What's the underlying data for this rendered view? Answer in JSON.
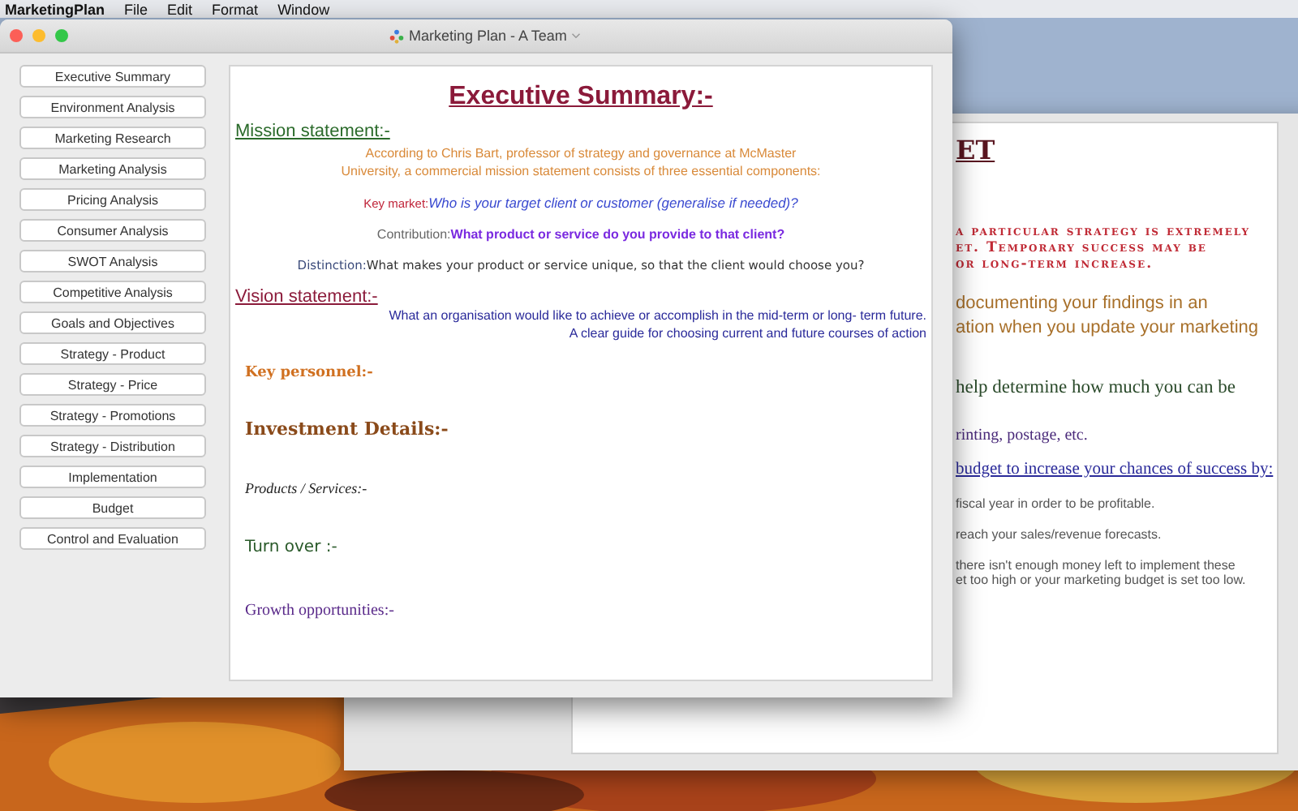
{
  "menubar": {
    "app": "MarketingPlan",
    "items": [
      "File",
      "Edit",
      "Format",
      "Window"
    ]
  },
  "back_window": {
    "blocks": [
      {
        "kind": "heading",
        "lines": [
          "ET"
        ]
      },
      {
        "kind": "caps",
        "lines": [
          "a particular strategy is extremely",
          "et. Temporary success may be",
          "or long-term increase."
        ]
      },
      {
        "kind": "brown",
        "lines": [
          "documenting your findings in an",
          "ation when you update your marketing"
        ]
      },
      {
        "kind": "green",
        "lines": [
          "help determine how much you can be"
        ]
      },
      {
        "kind": "purple",
        "lines": [
          "rinting, postage, etc."
        ]
      },
      {
        "kind": "link",
        "lines": [
          "budget to increase your chances of success by:"
        ]
      },
      {
        "kind": "grey",
        "lines": [
          "fiscal year in order to be profitable."
        ]
      },
      {
        "kind": "grey",
        "lines": [
          "reach your sales/revenue forecasts."
        ]
      },
      {
        "kind": "grey",
        "lines": [
          "there isn't enough money left to implement these",
          "et too high or your marketing budget is set too low."
        ]
      }
    ]
  },
  "window": {
    "title": "Marketing Plan - A Team",
    "sidebar": {
      "items": [
        "Executive Summary",
        "Environment Analysis",
        "Marketing Research",
        "Marketing Analysis",
        "Pricing Analysis",
        "Consumer Analysis",
        "SWOT Analysis",
        "Competitive Analysis",
        "Goals and Objectives",
        "Strategy - Product",
        "Strategy - Price",
        "Strategy - Promotions",
        "Strategy - Distribution",
        "Implementation",
        "Budget",
        "Control and Evaluation"
      ]
    },
    "document": {
      "blocks": [
        {
          "kind": "title",
          "lines": [
            "Executive Summary:-"
          ]
        },
        {
          "kind": "mission",
          "lines": [
            "Mission statement:-"
          ]
        },
        {
          "kind": "intro",
          "lines": [
            "According to Chris Bart, professor of strategy and governance at McMaster",
            "University, a commercial mission statement consists of three essential components:"
          ]
        },
        {
          "kind": "keymarket",
          "label": "Key market:",
          "text": "Who is your target client or customer (generalise if needed)?"
        },
        {
          "kind": "contribution",
          "label": "Contribution:",
          "text": "What product or service do you provide to that client?"
        },
        {
          "kind": "distinction",
          "label": "Distinction:",
          "text": "What makes your product or service unique, so that the client would choose you?"
        },
        {
          "kind": "vision",
          "lines": [
            "Vision statement:-"
          ]
        },
        {
          "kind": "visiontext",
          "lines": [
            "What an organisation would like to achieve or accomplish in the mid-term or long- term future.",
            "A clear guide for choosing current and future courses of action"
          ]
        },
        {
          "kind": "personnel",
          "lines": [
            "Key personnel:-"
          ]
        },
        {
          "kind": "investment",
          "lines": [
            "Investment Details:-"
          ]
        },
        {
          "kind": "products",
          "lines": [
            "Products / Services:-"
          ]
        },
        {
          "kind": "turnover",
          "lines": [
            "Turn over :-"
          ]
        },
        {
          "kind": "growth",
          "lines": [
            "Growth opportunities:-"
          ]
        }
      ]
    }
  }
}
